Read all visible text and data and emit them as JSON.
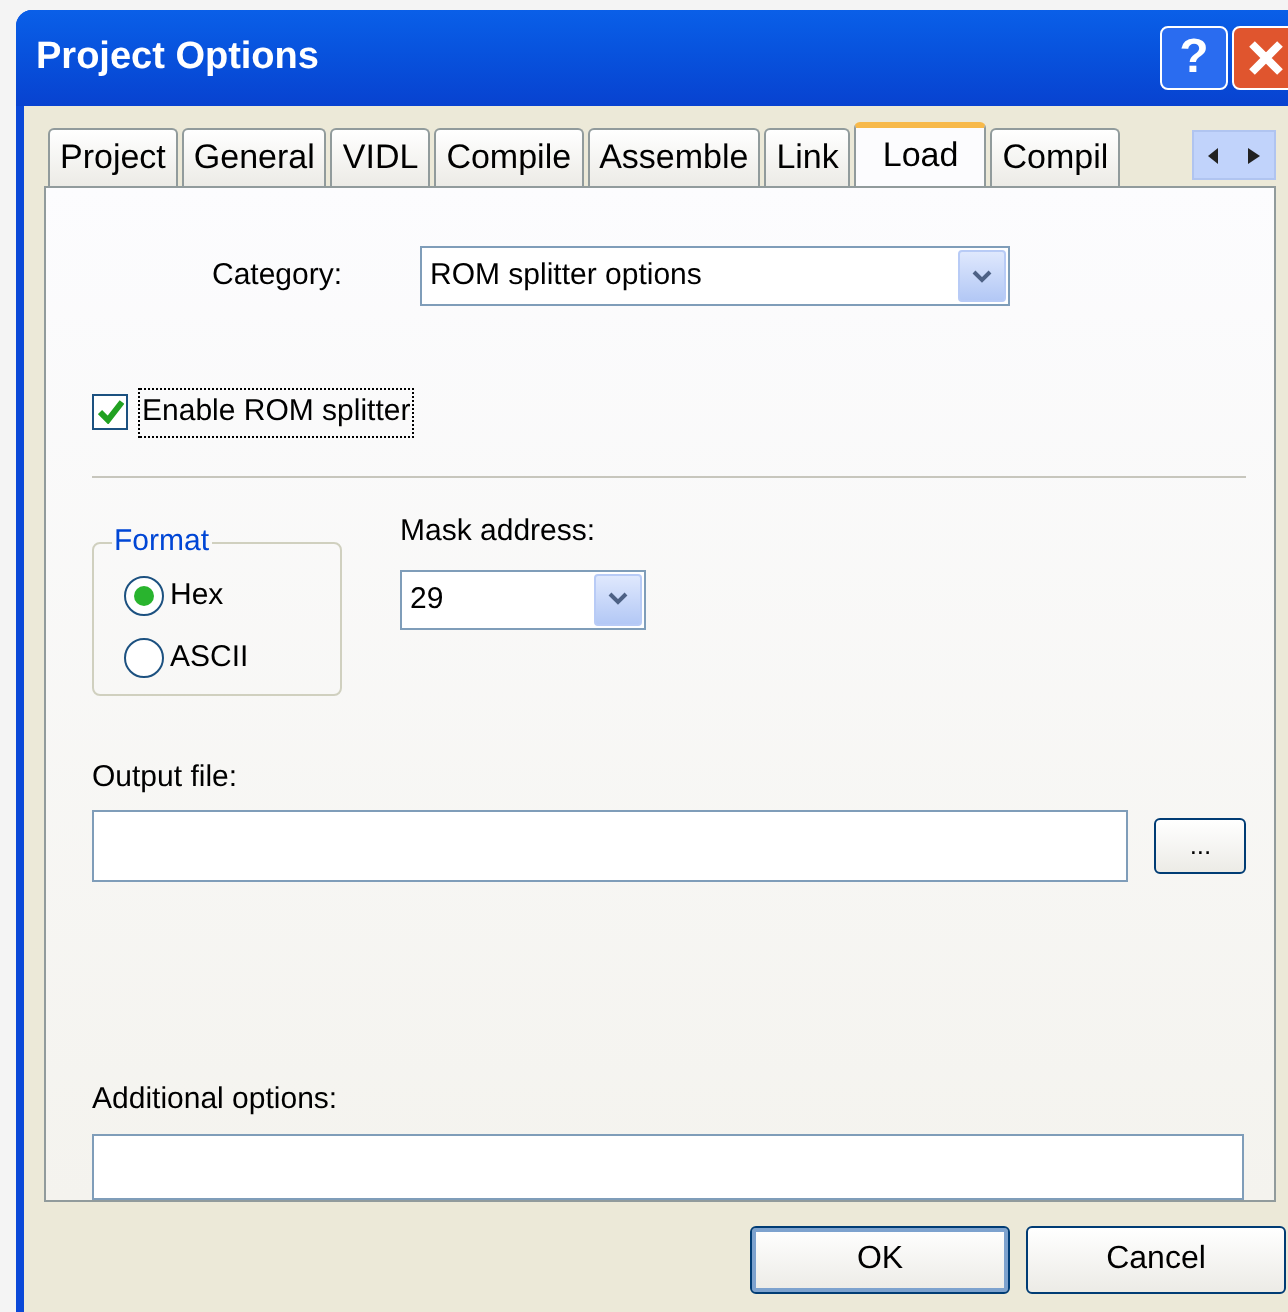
{
  "window": {
    "title": "Project Options",
    "help_label": "?"
  },
  "tabs": [
    {
      "label": "Project",
      "selected": false
    },
    {
      "label": "General",
      "selected": false
    },
    {
      "label": "VIDL",
      "selected": false
    },
    {
      "label": "Compile",
      "selected": false
    },
    {
      "label": "Assemble",
      "selected": false
    },
    {
      "label": "Link",
      "selected": false
    },
    {
      "label": "Load",
      "selected": true
    },
    {
      "label": "Compil",
      "selected": false
    }
  ],
  "category": {
    "label": "Category:",
    "value": "ROM splitter options"
  },
  "enable_rom_splitter": {
    "label": "Enable ROM splitter",
    "checked": true
  },
  "format": {
    "legend": "Format",
    "options": [
      {
        "label": "Hex",
        "selected": true
      },
      {
        "label": "ASCII",
        "selected": false
      }
    ]
  },
  "mask_address": {
    "label": "Mask address:",
    "value": "29"
  },
  "output_file": {
    "label": "Output file:",
    "browse": "..."
  },
  "additional_options": {
    "label": "Additional options:"
  },
  "buttons": [
    {
      "label": "OK",
      "default": true
    },
    {
      "label": "Cancel",
      "default": false
    }
  ]
}
